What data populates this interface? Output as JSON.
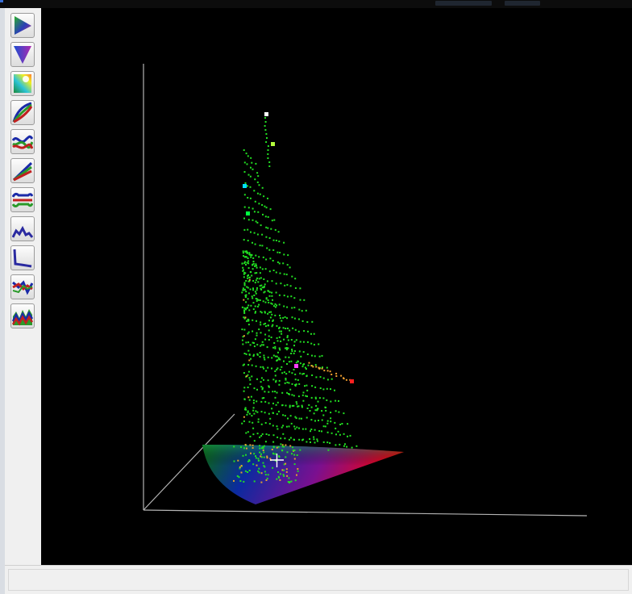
{
  "window": {
    "title": "",
    "status_text": ""
  },
  "toolbar": {
    "buttons": [
      {
        "name": "gamut-triangle-view",
        "icon": "gamut-triangle-icon"
      },
      {
        "name": "inverted-gamut-view",
        "icon": "inverted-gamut-icon"
      },
      {
        "name": "color-cube-view",
        "icon": "color-cube-icon"
      },
      {
        "name": "tone-curves-view",
        "icon": "tone-curves-icon"
      },
      {
        "name": "rgb-balance-view",
        "icon": "rgb-balance-icon"
      },
      {
        "name": "linearity-view",
        "icon": "linearity-icon"
      },
      {
        "name": "rgb-tracking-view",
        "icon": "rgb-tracking-icon"
      },
      {
        "name": "delta-e-graph-view",
        "icon": "delta-e-graph-icon"
      },
      {
        "name": "gamma-decay-view",
        "icon": "gamma-decay-icon"
      },
      {
        "name": "rgb-error-view",
        "icon": "rgb-error-icon"
      },
      {
        "name": "rgb-spectrum-view",
        "icon": "rgb-spectrum-icon"
      }
    ]
  },
  "scene": {
    "type": "3d-color-gamut-plot",
    "background": "#000000",
    "axis_color": "#b4b4b4",
    "point_color": "#22e022",
    "gamut_colors": [
      "#0a6d0a",
      "#0b2aa0",
      "#7a1090",
      "#ff0000"
    ],
    "markers": [
      {
        "label": "white",
        "color": "#ffffff"
      },
      {
        "label": "yellow-green",
        "color": "#b4ff3c"
      },
      {
        "label": "cyan",
        "color": "#00e0ff"
      },
      {
        "label": "green",
        "color": "#00ff40"
      },
      {
        "label": "magenta",
        "color": "#ff40ff"
      },
      {
        "label": "red",
        "color": "#ff2020"
      }
    ]
  }
}
